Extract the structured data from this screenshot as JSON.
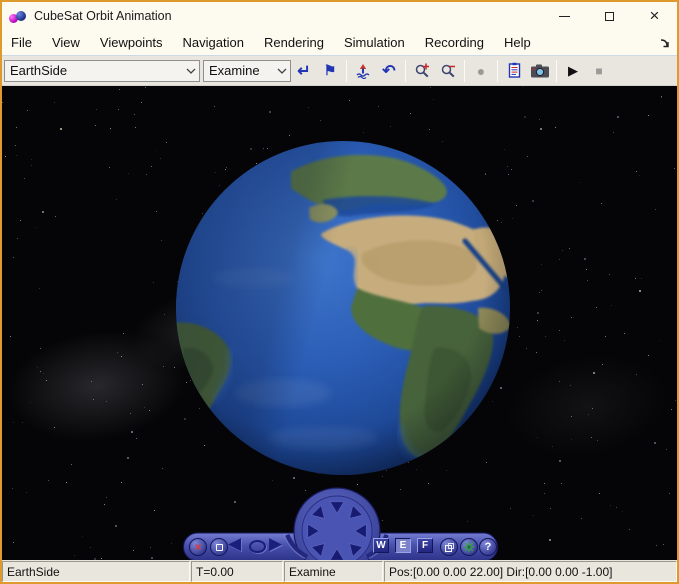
{
  "window": {
    "title": "CubeSat Orbit Animation",
    "minimize": "–",
    "close": "×"
  },
  "menu": {
    "items": [
      "File",
      "View",
      "Viewpoints",
      "Navigation",
      "Rendering",
      "Simulation",
      "Recording",
      "Help"
    ]
  },
  "toolbar": {
    "viewpoint": "EarthSide",
    "navigation_mode": "Examine",
    "glyphs": {
      "goto_viewpoint": "↵",
      "create_viewpoint": "⚑",
      "undo_move": "↶",
      "record": "●",
      "play": "▶",
      "stop": "■"
    }
  },
  "wheelbar": {
    "close": "×",
    "walk": "W",
    "examine": "E",
    "fly": "F",
    "help": "?"
  },
  "statusbar": {
    "viewpoint": "EarthSide",
    "time": "T=0.00",
    "mode": "Examine",
    "pose": "Pos:[0.00 0.00 22.00] Dir:[0.00 0.00 -1.00]"
  },
  "colors": {
    "window_border": "#df9a2e",
    "chrome_bg": "#fdfaf0",
    "space": "#050507",
    "controlbar_blue": "#4750ac",
    "earth_ocean": "#2a5cb4",
    "icon_blue": "#2236b4"
  }
}
